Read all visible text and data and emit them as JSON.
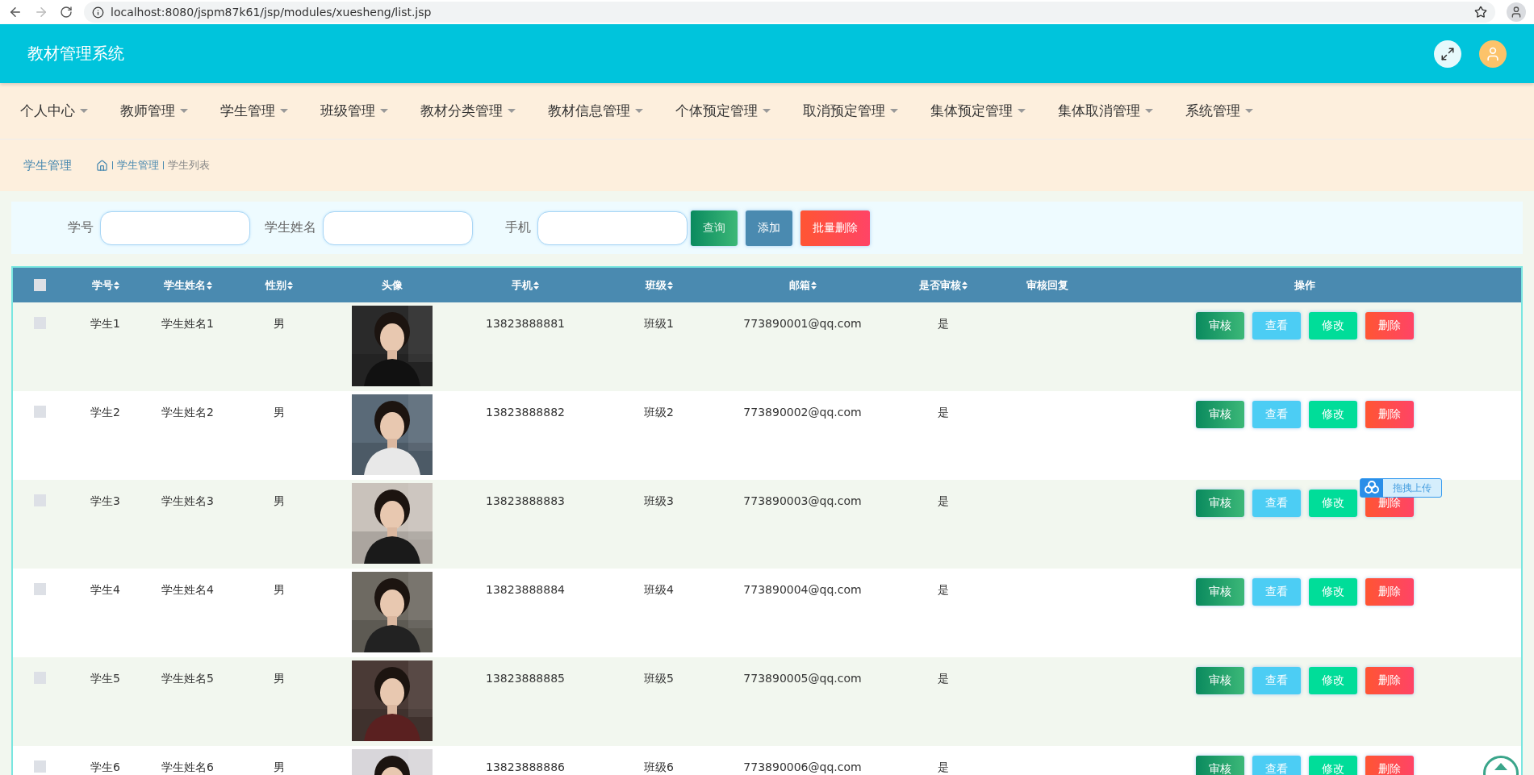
{
  "browser": {
    "url": "localhost:8080/jspm87k61/jsp/modules/xuesheng/list.jsp"
  },
  "header": {
    "title": "教材管理系统"
  },
  "nav": [
    {
      "label": "个人中心"
    },
    {
      "label": "教师管理"
    },
    {
      "label": "学生管理"
    },
    {
      "label": "班级管理"
    },
    {
      "label": "教材分类管理"
    },
    {
      "label": "教材信息管理"
    },
    {
      "label": "个体预定管理"
    },
    {
      "label": "取消预定管理"
    },
    {
      "label": "集体预定管理"
    },
    {
      "label": "集体取消管理"
    },
    {
      "label": "系统管理"
    }
  ],
  "breadcrumb": {
    "title": "学生管理",
    "path": [
      "学生管理",
      "学生列表"
    ]
  },
  "search": {
    "fields": [
      {
        "label": "学号"
      },
      {
        "label": "学生姓名"
      },
      {
        "label": "手机"
      }
    ],
    "buttons": [
      {
        "label": "查询",
        "kind": "search"
      },
      {
        "label": "添加",
        "kind": "add"
      },
      {
        "label": "批量删除",
        "kind": "delete"
      }
    ]
  },
  "table": {
    "all_checked": false,
    "columns": [
      {
        "label": "学号",
        "sortable": true
      },
      {
        "label": "学生姓名",
        "sortable": true
      },
      {
        "label": "性别",
        "sortable": true
      },
      {
        "label": "头像",
        "sortable": false
      },
      {
        "label": "手机",
        "sortable": true
      },
      {
        "label": "班级",
        "sortable": true
      },
      {
        "label": "邮箱",
        "sortable": true
      },
      {
        "label": "是否审核",
        "sortable": true
      },
      {
        "label": "审核回复",
        "sortable": false
      },
      {
        "label": "操作",
        "sortable": false
      }
    ],
    "rows": [
      {
        "checked": false,
        "cells": [
          "学生1",
          "学生姓名1",
          "男",
          "",
          "13823888881",
          "班级1",
          "773890001@qq.com",
          "是",
          ""
        ],
        "actions": [
          {
            "label": "审核",
            "kind": "review"
          },
          {
            "label": "查看",
            "kind": "view"
          },
          {
            "label": "修改",
            "kind": "edit"
          },
          {
            "label": "删除",
            "kind": "delete"
          }
        ]
      },
      {
        "checked": false,
        "cells": [
          "学生2",
          "学生姓名2",
          "男",
          "",
          "13823888882",
          "班级2",
          "773890002@qq.com",
          "是",
          ""
        ],
        "actions": [
          {
            "label": "审核",
            "kind": "review"
          },
          {
            "label": "查看",
            "kind": "view"
          },
          {
            "label": "修改",
            "kind": "edit"
          },
          {
            "label": "删除",
            "kind": "delete"
          }
        ]
      },
      {
        "checked": false,
        "cells": [
          "学生3",
          "学生姓名3",
          "男",
          "",
          "13823888883",
          "班级3",
          "773890003@qq.com",
          "是",
          ""
        ],
        "actions": [
          {
            "label": "审核",
            "kind": "review"
          },
          {
            "label": "查看",
            "kind": "view"
          },
          {
            "label": "修改",
            "kind": "edit"
          },
          {
            "label": "删除",
            "kind": "delete"
          }
        ]
      },
      {
        "checked": false,
        "cells": [
          "学生4",
          "学生姓名4",
          "男",
          "",
          "13823888884",
          "班级4",
          "773890004@qq.com",
          "是",
          ""
        ],
        "actions": [
          {
            "label": "审核",
            "kind": "review"
          },
          {
            "label": "查看",
            "kind": "view"
          },
          {
            "label": "修改",
            "kind": "edit"
          },
          {
            "label": "删除",
            "kind": "delete"
          }
        ]
      },
      {
        "checked": false,
        "cells": [
          "学生5",
          "学生姓名5",
          "男",
          "",
          "13823888885",
          "班级5",
          "773890005@qq.com",
          "是",
          ""
        ],
        "actions": [
          {
            "label": "审核",
            "kind": "review"
          },
          {
            "label": "查看",
            "kind": "view"
          },
          {
            "label": "修改",
            "kind": "edit"
          },
          {
            "label": "删除",
            "kind": "delete"
          }
        ]
      },
      {
        "checked": false,
        "cells": [
          "学生6",
          "学生姓名6",
          "男",
          "",
          "13823888886",
          "班级6",
          "773890006@qq.com",
          "是",
          ""
        ],
        "actions": [
          {
            "label": "审核",
            "kind": "review"
          },
          {
            "label": "查看",
            "kind": "view"
          },
          {
            "label": "修改",
            "kind": "edit"
          },
          {
            "label": "删除",
            "kind": "delete"
          }
        ]
      }
    ]
  },
  "upload_widget": {
    "label": "拖拽上传"
  }
}
